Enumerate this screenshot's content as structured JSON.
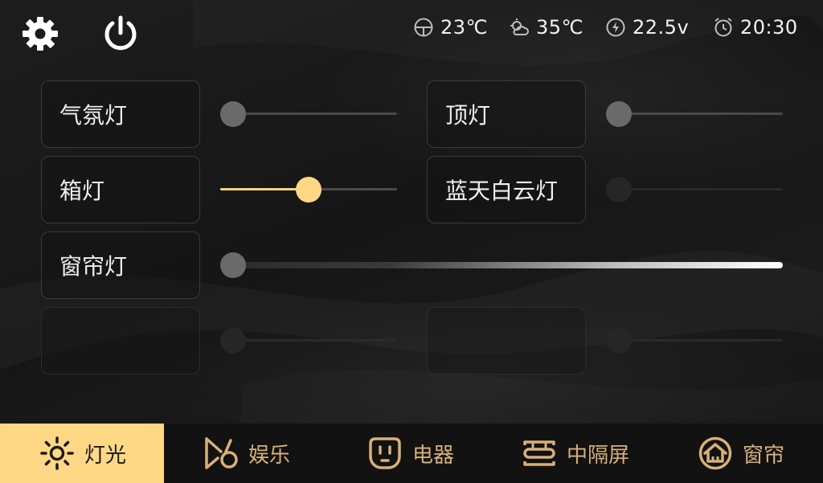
{
  "status": {
    "temperature_inside": "23℃",
    "temperature_outside": "35℃",
    "voltage": "22.5v",
    "clock": "20:30"
  },
  "lights": [
    {
      "label": "气氛灯",
      "level": 0.0
    },
    {
      "label": "顶灯",
      "level": 0.0
    },
    {
      "label": "箱灯",
      "level": 0.5
    },
    {
      "label": "蓝天白云灯",
      "level": 0.0
    },
    {
      "label": "窗帘灯",
      "level": 0.0
    },
    {
      "label": "",
      "level": 0.0
    },
    {
      "label": "",
      "level": 0.0
    }
  ],
  "nav": [
    {
      "label": "灯光",
      "icon": "sun-icon",
      "active": true
    },
    {
      "label": "娱乐",
      "icon": "media-icon",
      "active": false
    },
    {
      "label": "电器",
      "icon": "socket-icon",
      "active": false
    },
    {
      "label": "中隔屏",
      "icon": "partition-icon",
      "active": false
    },
    {
      "label": "窗帘",
      "icon": "curtain-icon",
      "active": false
    }
  ],
  "colors": {
    "accent": "#ffd886",
    "nav_text": "#d8b07a",
    "background": "#141414"
  }
}
